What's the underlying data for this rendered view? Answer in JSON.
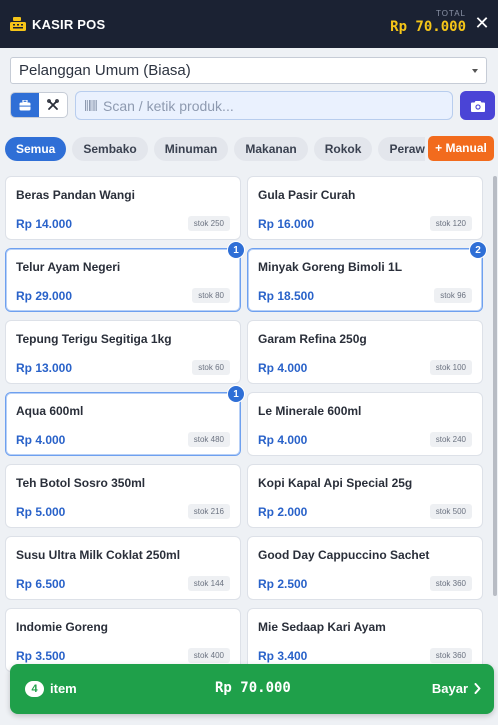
{
  "header": {
    "title": "KASIR POS",
    "logo_icon": "cash-register-icon",
    "total_label": "TOTAL",
    "total_value": "Rp 70.000",
    "close_label": "✕",
    "accent_color": "#f5c518"
  },
  "customer": {
    "selected": "Pelanggan Umum (Biasa)"
  },
  "tools": {
    "modes": [
      {
        "icon": "grid-view-icon",
        "active": true
      },
      {
        "icon": "tools-icon",
        "active": false
      }
    ],
    "scan_placeholder": "Scan / ketik produk...",
    "scan_value": "",
    "barcode_icon": "barcode-icon",
    "camera_icon": "camera-icon"
  },
  "categories": {
    "tabs": [
      "Semua",
      "Sembako",
      "Minuman",
      "Makanan",
      "Rokok",
      "Perawatan"
    ],
    "active_index": 0,
    "manual_label": "+ Manual"
  },
  "products": [
    {
      "name": "Beras Pandan Wangi",
      "price": "Rp 14.000",
      "stock": "stok 250",
      "qty": null
    },
    {
      "name": "Gula Pasir Curah",
      "price": "Rp 16.000",
      "stock": "stok 120",
      "qty": null
    },
    {
      "name": "Telur Ayam Negeri",
      "price": "Rp 29.000",
      "stock": "stok 80",
      "qty": "1"
    },
    {
      "name": "Minyak Goreng Bimoli 1L",
      "price": "Rp 18.500",
      "stock": "stok 96",
      "qty": "2"
    },
    {
      "name": "Tepung Terigu Segitiga 1kg",
      "price": "Rp 13.000",
      "stock": "stok 60",
      "qty": null
    },
    {
      "name": "Garam Refina 250g",
      "price": "Rp 4.000",
      "stock": "stok 100",
      "qty": null
    },
    {
      "name": "Aqua 600ml",
      "price": "Rp 4.000",
      "stock": "stok 480",
      "qty": "1"
    },
    {
      "name": "Le Minerale 600ml",
      "price": "Rp 4.000",
      "stock": "stok 240",
      "qty": null
    },
    {
      "name": "Teh Botol Sosro 350ml",
      "price": "Rp 5.000",
      "stock": "stok 216",
      "qty": null
    },
    {
      "name": "Kopi Kapal Api Special 25g",
      "price": "Rp 2.000",
      "stock": "stok 500",
      "qty": null
    },
    {
      "name": "Susu Ultra Milk Coklat 250ml",
      "price": "Rp 6.500",
      "stock": "stok 144",
      "qty": null
    },
    {
      "name": "Good Day Cappuccino Sachet",
      "price": "Rp 2.500",
      "stock": "stok 360",
      "qty": null
    },
    {
      "name": "Indomie Goreng",
      "price": "Rp 3.500",
      "stock": "stok 400",
      "qty": null
    },
    {
      "name": "Mie Sedaap Kari Ayam",
      "price": "Rp 3.400",
      "stock": "stok 360",
      "qty": null
    }
  ],
  "cart": {
    "count": "4",
    "item_label": "item",
    "total": "Rp 70.000",
    "pay_label": "Bayar",
    "pay_icon": "chevron-right-icon",
    "color": "#1fa04a"
  }
}
